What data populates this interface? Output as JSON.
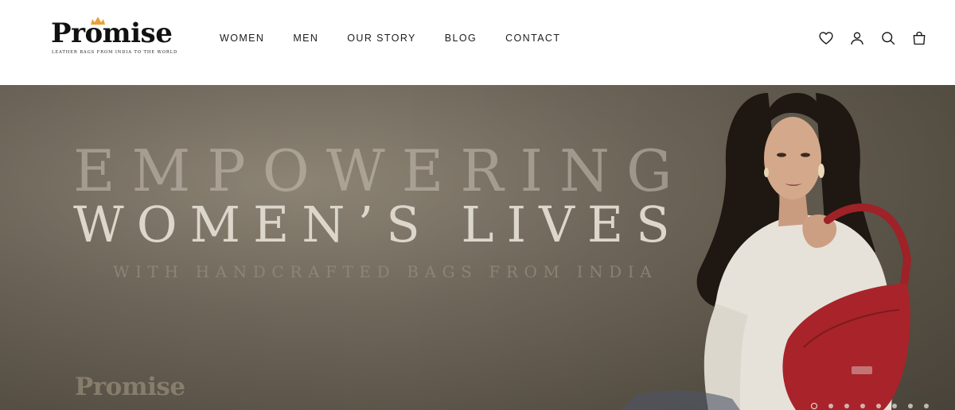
{
  "brand": {
    "name": "Promise",
    "tagline": "LEATHER BAGS FROM INDIA TO THE WORLD",
    "accent_color": "#e8a23a"
  },
  "nav": {
    "items": [
      {
        "label": "WOMEN"
      },
      {
        "label": "MEN"
      },
      {
        "label": "OUR STORY"
      },
      {
        "label": "BLOG"
      },
      {
        "label": "CONTACT"
      }
    ]
  },
  "header_icons": [
    "heart-icon",
    "account-icon",
    "search-icon",
    "bag-icon"
  ],
  "hero": {
    "line1": "EMPOWERING",
    "line2": "WOMEN’S LIVES",
    "line3": "WITH HANDCRAFTED BAGS FROM INDIA",
    "watermark": "Promise",
    "bag_color": "#a8242a",
    "background_color": "#6f675a"
  },
  "carousel": {
    "slide_count": 8,
    "active_slide": 1
  }
}
